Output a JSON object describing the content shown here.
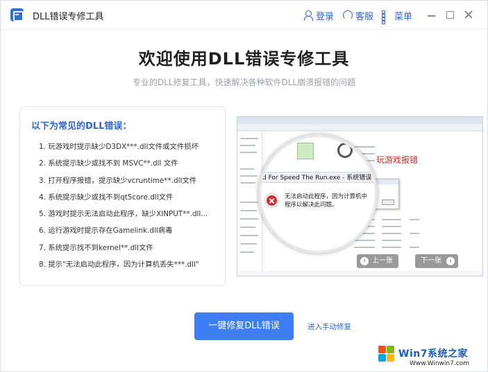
{
  "app": {
    "title": "DLL错误专修工具"
  },
  "titlebar": {
    "login_label": "登录",
    "service_label": "客服",
    "menu_label": "菜单",
    "icons": [
      "user-icon",
      "headset-icon",
      "grid-menu-icon",
      "minimize-icon",
      "maximize-icon",
      "close-icon"
    ]
  },
  "main": {
    "headline": "欢迎使用DLL错误专修工具",
    "subline": "专业的DLL修复工具，快速解决各种软件DLL崩溃报错的问题"
  },
  "errors_card": {
    "title": "以下为常见的DLL错误：",
    "items": [
      "1. 玩游戏时提示缺少D3DX***.dll文件或文件损坏",
      "2. 系统提示缺少或找不到 MSVC**.dll 文件",
      "3. 打开程序报错，提示缺少vcruntime**.dll文件",
      "4. 系统提示缺少或找不到qt5core.dll文件",
      "5. 游戏时提示无法启动此程序，缺少XINPUT**.dll...",
      "6. 运行游戏时提示存在Gamelink.dll病毒",
      "7. 系统提示找不到kernel**.dll文件",
      "8. 提示\"无法启动此程序，因为计算机丢失***.dll\""
    ]
  },
  "preview": {
    "caption": "玩游戏报错",
    "window_title_fragment": "d For Speed The Run.exe - 系统错误",
    "error_message_line1": "无法启动此程序，因为计算机中",
    "error_message_line2": "程序以解决此问题。",
    "prev_label": "上一张",
    "next_label": "下一张"
  },
  "actions": {
    "repair_button": "一键修复DLL错误",
    "manual_link": "进入手动修复"
  },
  "watermark": {
    "brand": "Win7系统之家",
    "url": "Www.Winwin7.com"
  },
  "colors": {
    "accent": "#2a66d9",
    "primary_button": "#3d7ef5",
    "caption_red": "#e02424",
    "error_icon": "#d42b2b"
  }
}
